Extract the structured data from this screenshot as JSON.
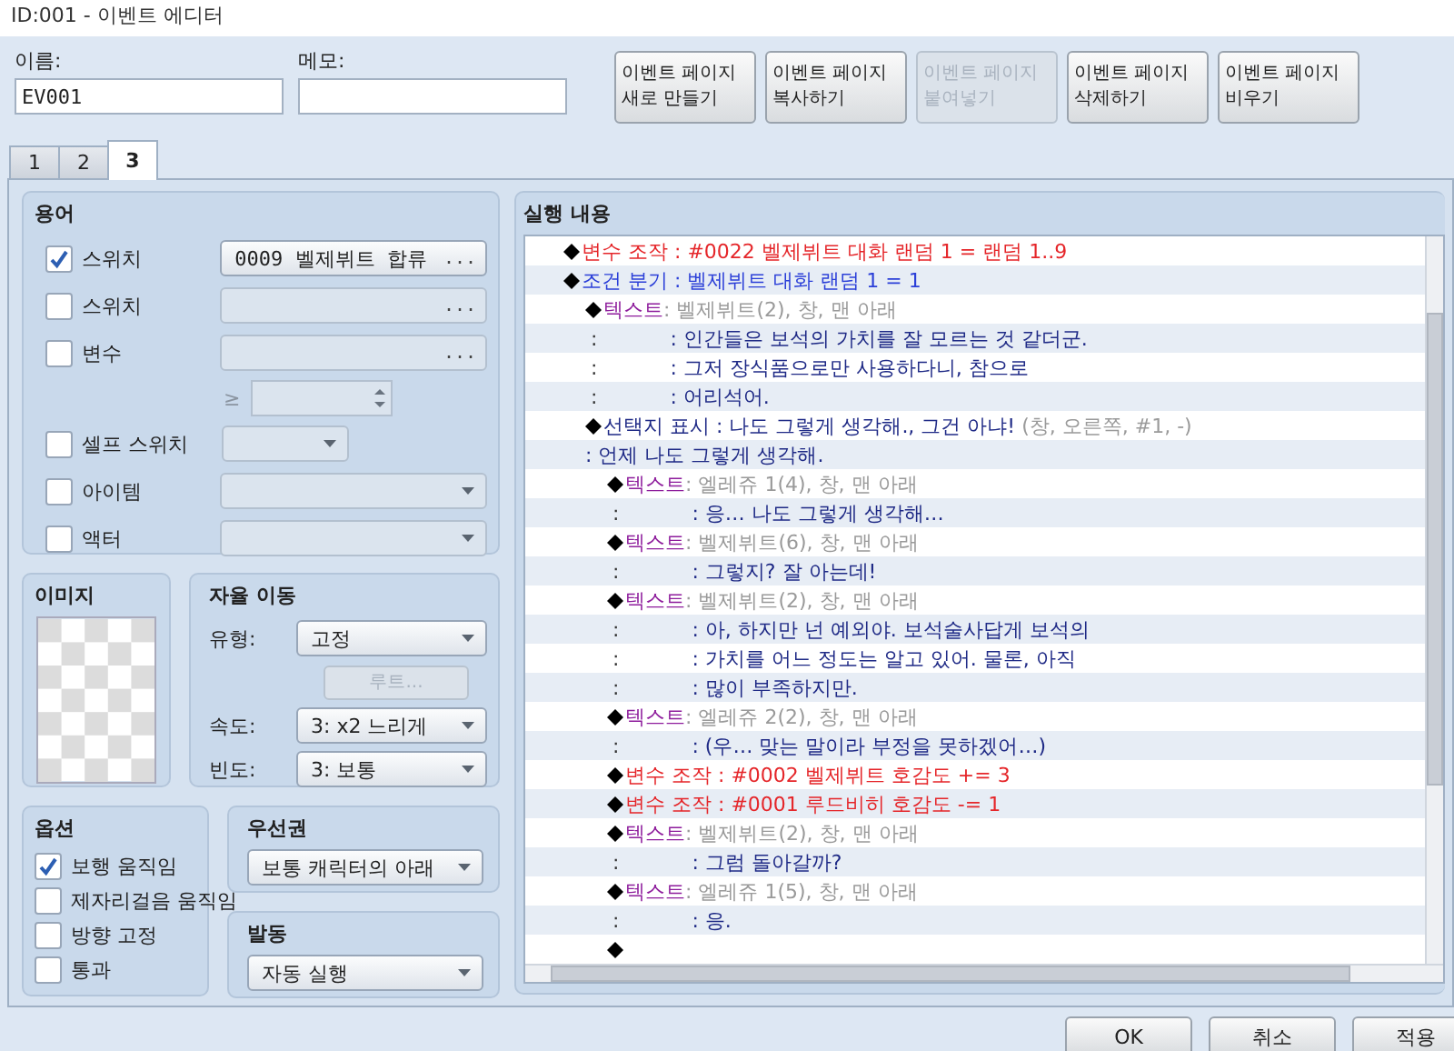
{
  "window": {
    "title": "ID:001 - 이벤트 에디터"
  },
  "name_field": {
    "label": "이름:",
    "value": "EV001"
  },
  "memo_field": {
    "label": "메모:"
  },
  "page_buttons": [
    {
      "label": "이벤트 페이지\n새로 만들기",
      "disabled": false
    },
    {
      "label": "이벤트 페이지\n복사하기",
      "disabled": false
    },
    {
      "label": "이벤트 페이지\n붙여넣기",
      "disabled": true
    },
    {
      "label": "이벤트 페이지\n삭제하기",
      "disabled": false
    },
    {
      "label": "이벤트 페이지\n비우기",
      "disabled": false
    }
  ],
  "tabs": [
    {
      "label": "1",
      "selected": false
    },
    {
      "label": "2",
      "selected": false
    },
    {
      "label": "3",
      "selected": true
    }
  ],
  "conditions": {
    "title": "용어",
    "rows": [
      {
        "kind": "picker",
        "label": "스위치",
        "checked": true,
        "value": "0009 벨제뷔트 합류",
        "button": "...",
        "disabled": false
      },
      {
        "kind": "picker",
        "label": "스위치",
        "checked": false,
        "button": "...",
        "disabled": true
      },
      {
        "kind": "picker",
        "label": "변수",
        "checked": false,
        "button": "...",
        "disabled": true,
        "compare": {
          "operator": "≥"
        }
      },
      {
        "kind": "small-select",
        "label": "셀프 스위치",
        "checked": false,
        "disabled": true
      },
      {
        "kind": "select",
        "label": "아이템",
        "checked": false,
        "disabled": true
      },
      {
        "kind": "select",
        "label": "액터",
        "checked": false,
        "disabled": true
      }
    ]
  },
  "image": {
    "title": "이미지"
  },
  "autonomous_movement": {
    "title": "자율 이동",
    "type": {
      "label": "유형:",
      "value": "고정"
    },
    "route_button": {
      "label": "루트...",
      "disabled": true
    },
    "speed": {
      "label": "속도:",
      "value": "3: x2 느리게"
    },
    "frequency": {
      "label": "빈도:",
      "value": "3: 보통"
    }
  },
  "options": {
    "title": "옵션",
    "items": [
      {
        "label": "보행 움직임",
        "checked": true
      },
      {
        "label": "제자리걸음 움직임",
        "checked": false
      },
      {
        "label": "방향 고정",
        "checked": false
      },
      {
        "label": "통과",
        "checked": false
      }
    ]
  },
  "priority": {
    "title": "우선권",
    "value": "보통 캐릭터의 아래"
  },
  "trigger": {
    "title": "발동",
    "value": "자동 실행"
  },
  "contents": {
    "title": "실행 내용",
    "commands": [
      {
        "kind": "variable",
        "text": "변수 조작 : #0022 벨제뷔트 대화 랜덤 1 = 랜덤 1..9"
      },
      {
        "kind": "branch",
        "text": "조건 분기 : 벨제뷔트 대화 랜덤 1 = 1",
        "children": [
          {
            "kind": "text",
            "label": "텍스트",
            "params": ": 벨제뷔트(2), 창, 맨 아래",
            "lines": [
              {
                "mark": ":",
                "text": ": 인간들은 보석의 가치를 잘 모르는 것 같더군."
              },
              {
                "mark": ":",
                "text": ": 그저 장식품으로만 사용하다니, 참으로"
              },
              {
                "mark": ":",
                "text": ": 어리석어."
              }
            ]
          },
          {
            "kind": "choice",
            "text": "선택지 표시 : 나도 그렇게 생각해., 그건 아냐!",
            "params": "(창, 오른쪽, #1, -)"
          },
          {
            "kind": "when",
            "text": ": 언제 나도 그렇게 생각해.",
            "children": [
              {
                "kind": "text",
                "label": "텍스트",
                "params": ": 엘레쥬 1(4), 창, 맨 아래",
                "lines": [
                  {
                    "mark": ":",
                    "text": ": 응… 나도 그렇게 생각해…"
                  }
                ]
              },
              {
                "kind": "text",
                "label": "텍스트",
                "params": ": 벨제뷔트(6), 창, 맨 아래",
                "lines": [
                  {
                    "mark": ":",
                    "text": ": 그렇지? 잘 아는데!"
                  }
                ]
              },
              {
                "kind": "text",
                "label": "텍스트",
                "params": ": 벨제뷔트(2), 창, 맨 아래",
                "lines": [
                  {
                    "mark": ":",
                    "text": ": 아, 하지만 넌 예외야. 보석술사답게 보석의"
                  },
                  {
                    "mark": ":",
                    "text": ": 가치를 어느 정도는 알고 있어. 물론, 아직"
                  },
                  {
                    "mark": ":",
                    "text": ": 많이 부족하지만."
                  }
                ]
              },
              {
                "kind": "text",
                "label": "텍스트",
                "params": ": 엘레쥬 2(2), 창, 맨 아래",
                "lines": [
                  {
                    "mark": ":",
                    "text": ": (우… 맞는 말이라 부정을 못하겠어…)"
                  }
                ]
              },
              {
                "kind": "variable",
                "text": "변수 조작 : #0002 벨제뷔트 호감도 += 3"
              },
              {
                "kind": "variable",
                "text": "변수 조작 : #0001 루드비히 호감도 -= 1"
              },
              {
                "kind": "text",
                "label": "텍스트",
                "params": ": 벨제뷔트(2), 창, 맨 아래",
                "lines": [
                  {
                    "mark": ":",
                    "text": ": 그럼 돌아갈까?"
                  }
                ]
              },
              {
                "kind": "text",
                "label": "텍스트",
                "params": ": 엘레쥬 1(5), 창, 맨 아래",
                "lines": [
                  {
                    "mark": ":",
                    "text": ": 응."
                  }
                ]
              },
              {
                "kind": "end"
              }
            ]
          }
        ]
      }
    ]
  },
  "buttons": [
    {
      "label": "OK"
    },
    {
      "label": "취소"
    },
    {
      "label": "적용"
    }
  ]
}
